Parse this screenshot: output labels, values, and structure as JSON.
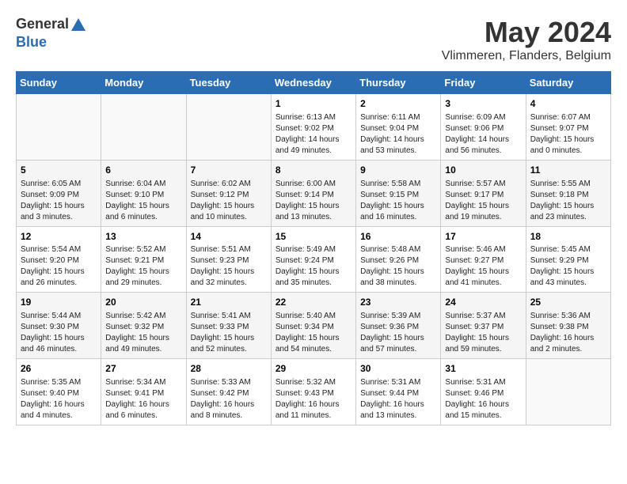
{
  "header": {
    "logo_general": "General",
    "logo_blue": "Blue",
    "month": "May 2024",
    "location": "Vlimmeren, Flanders, Belgium"
  },
  "weekdays": [
    "Sunday",
    "Monday",
    "Tuesday",
    "Wednesday",
    "Thursday",
    "Friday",
    "Saturday"
  ],
  "weeks": [
    [
      {
        "day": "",
        "info": ""
      },
      {
        "day": "",
        "info": ""
      },
      {
        "day": "",
        "info": ""
      },
      {
        "day": "1",
        "info": "Sunrise: 6:13 AM\nSunset: 9:02 PM\nDaylight: 14 hours and 49 minutes."
      },
      {
        "day": "2",
        "info": "Sunrise: 6:11 AM\nSunset: 9:04 PM\nDaylight: 14 hours and 53 minutes."
      },
      {
        "day": "3",
        "info": "Sunrise: 6:09 AM\nSunset: 9:06 PM\nDaylight: 14 hours and 56 minutes."
      },
      {
        "day": "4",
        "info": "Sunrise: 6:07 AM\nSunset: 9:07 PM\nDaylight: 15 hours and 0 minutes."
      }
    ],
    [
      {
        "day": "5",
        "info": "Sunrise: 6:05 AM\nSunset: 9:09 PM\nDaylight: 15 hours and 3 minutes."
      },
      {
        "day": "6",
        "info": "Sunrise: 6:04 AM\nSunset: 9:10 PM\nDaylight: 15 hours and 6 minutes."
      },
      {
        "day": "7",
        "info": "Sunrise: 6:02 AM\nSunset: 9:12 PM\nDaylight: 15 hours and 10 minutes."
      },
      {
        "day": "8",
        "info": "Sunrise: 6:00 AM\nSunset: 9:14 PM\nDaylight: 15 hours and 13 minutes."
      },
      {
        "day": "9",
        "info": "Sunrise: 5:58 AM\nSunset: 9:15 PM\nDaylight: 15 hours and 16 minutes."
      },
      {
        "day": "10",
        "info": "Sunrise: 5:57 AM\nSunset: 9:17 PM\nDaylight: 15 hours and 19 minutes."
      },
      {
        "day": "11",
        "info": "Sunrise: 5:55 AM\nSunset: 9:18 PM\nDaylight: 15 hours and 23 minutes."
      }
    ],
    [
      {
        "day": "12",
        "info": "Sunrise: 5:54 AM\nSunset: 9:20 PM\nDaylight: 15 hours and 26 minutes."
      },
      {
        "day": "13",
        "info": "Sunrise: 5:52 AM\nSunset: 9:21 PM\nDaylight: 15 hours and 29 minutes."
      },
      {
        "day": "14",
        "info": "Sunrise: 5:51 AM\nSunset: 9:23 PM\nDaylight: 15 hours and 32 minutes."
      },
      {
        "day": "15",
        "info": "Sunrise: 5:49 AM\nSunset: 9:24 PM\nDaylight: 15 hours and 35 minutes."
      },
      {
        "day": "16",
        "info": "Sunrise: 5:48 AM\nSunset: 9:26 PM\nDaylight: 15 hours and 38 minutes."
      },
      {
        "day": "17",
        "info": "Sunrise: 5:46 AM\nSunset: 9:27 PM\nDaylight: 15 hours and 41 minutes."
      },
      {
        "day": "18",
        "info": "Sunrise: 5:45 AM\nSunset: 9:29 PM\nDaylight: 15 hours and 43 minutes."
      }
    ],
    [
      {
        "day": "19",
        "info": "Sunrise: 5:44 AM\nSunset: 9:30 PM\nDaylight: 15 hours and 46 minutes."
      },
      {
        "day": "20",
        "info": "Sunrise: 5:42 AM\nSunset: 9:32 PM\nDaylight: 15 hours and 49 minutes."
      },
      {
        "day": "21",
        "info": "Sunrise: 5:41 AM\nSunset: 9:33 PM\nDaylight: 15 hours and 52 minutes."
      },
      {
        "day": "22",
        "info": "Sunrise: 5:40 AM\nSunset: 9:34 PM\nDaylight: 15 hours and 54 minutes."
      },
      {
        "day": "23",
        "info": "Sunrise: 5:39 AM\nSunset: 9:36 PM\nDaylight: 15 hours and 57 minutes."
      },
      {
        "day": "24",
        "info": "Sunrise: 5:37 AM\nSunset: 9:37 PM\nDaylight: 15 hours and 59 minutes."
      },
      {
        "day": "25",
        "info": "Sunrise: 5:36 AM\nSunset: 9:38 PM\nDaylight: 16 hours and 2 minutes."
      }
    ],
    [
      {
        "day": "26",
        "info": "Sunrise: 5:35 AM\nSunset: 9:40 PM\nDaylight: 16 hours and 4 minutes."
      },
      {
        "day": "27",
        "info": "Sunrise: 5:34 AM\nSunset: 9:41 PM\nDaylight: 16 hours and 6 minutes."
      },
      {
        "day": "28",
        "info": "Sunrise: 5:33 AM\nSunset: 9:42 PM\nDaylight: 16 hours and 8 minutes."
      },
      {
        "day": "29",
        "info": "Sunrise: 5:32 AM\nSunset: 9:43 PM\nDaylight: 16 hours and 11 minutes."
      },
      {
        "day": "30",
        "info": "Sunrise: 5:31 AM\nSunset: 9:44 PM\nDaylight: 16 hours and 13 minutes."
      },
      {
        "day": "31",
        "info": "Sunrise: 5:31 AM\nSunset: 9:46 PM\nDaylight: 16 hours and 15 minutes."
      },
      {
        "day": "",
        "info": ""
      }
    ]
  ]
}
